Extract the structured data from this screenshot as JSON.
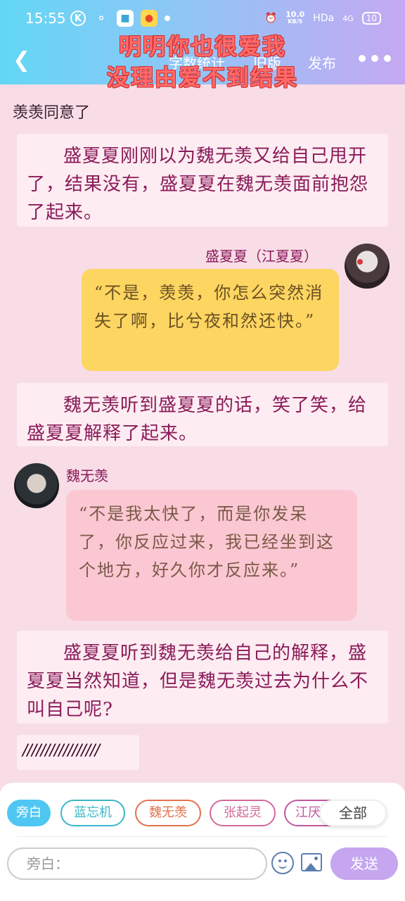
{
  "status_bar": {
    "time": "15:55",
    "net_speed": "10.0",
    "net_unit": "KB/S",
    "hd": "HDa",
    "signal": "4G",
    "battery": "10"
  },
  "nav": {
    "stat_label": "字数统计",
    "oldver_label": "旧版",
    "publish_label": "发布",
    "overlay_line1": "明明你也很爱我",
    "overlay_line2": "没理由爱不到结果"
  },
  "chat": {
    "system_line": "羡羡同意了",
    "narration_1": "盛夏夏刚刚以为魏无羡又给自己甩开了，结果没有，盛夏夏在魏无羡面前抱怨了起来。",
    "speaker_right": "盛夏夏（江夏夏）",
    "bubble_right": "“不是，羡羡，你怎么突然消失了啊，比兮夜和然还快。”",
    "narration_2": "魏无羡听到盛夏夏的话，笑了笑，给盛夏夏解释了起来。",
    "speaker_left": "魏无羡",
    "bubble_left": "“不是我太快了，而是你发呆了，你反应过来，我已经坐到这个地方，好久你才反应来。”",
    "narration_3": "盛夏夏听到魏无羡给自己的解释，盛夏夏当然知道，但是魏无羡过去为什么不叫自己呢?",
    "slashes": "/////////////////"
  },
  "composer": {
    "chips": [
      {
        "label": "旁白",
        "color": "#4fc7f2"
      },
      {
        "label": "蓝忘机",
        "color": "#3bb8c8"
      },
      {
        "label": "魏无羡",
        "color": "#e0734f"
      },
      {
        "label": "张起灵",
        "color": "#d36a9a"
      },
      {
        "label": "江厌",
        "color": "#c0589e"
      }
    ],
    "all_label": "全部",
    "input_placeholder": "旁白：",
    "send_label": "发送"
  }
}
